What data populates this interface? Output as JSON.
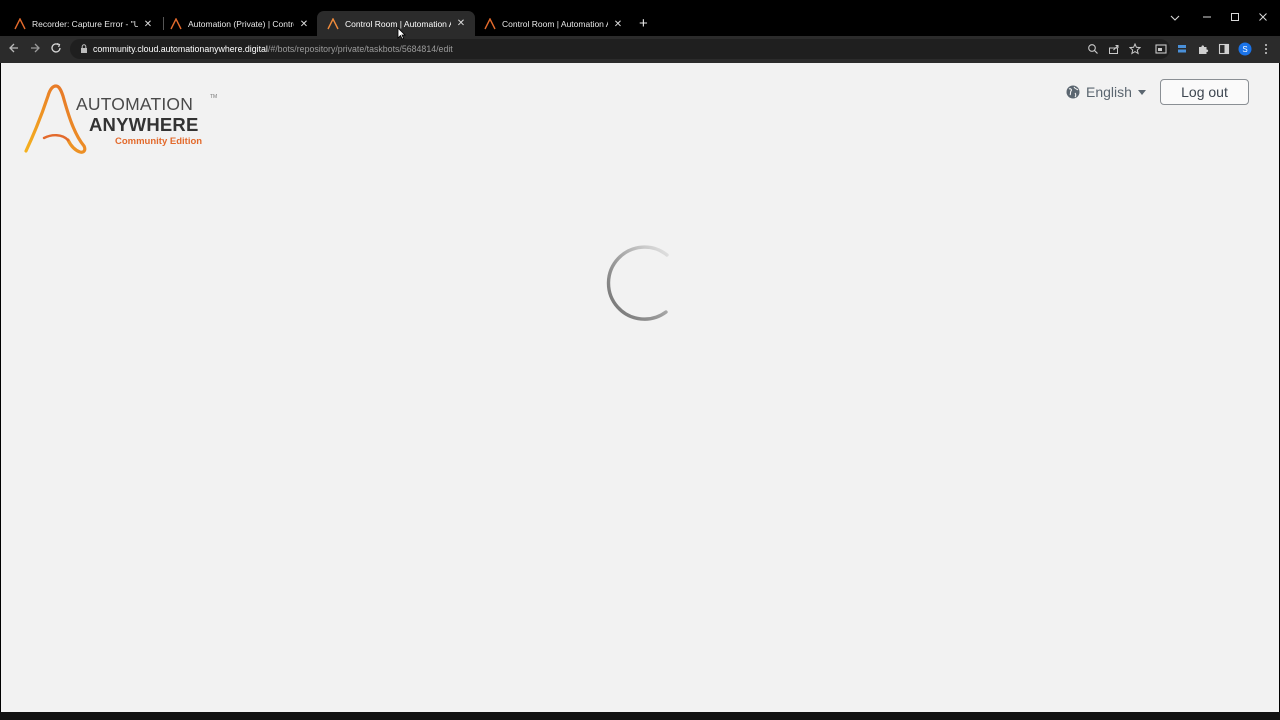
{
  "browser": {
    "tabs": [
      {
        "title": "Recorder: Capture Error - \"Unab",
        "active": false
      },
      {
        "title": "Automation (Private) | Control R",
        "active": false
      },
      {
        "title": "Control Room | Automation Any",
        "active": true
      },
      {
        "title": "Control Room | Automation Any",
        "active": false
      }
    ],
    "new_tab_glyph": "+",
    "close_glyph": "✕",
    "url_host": "community.cloud.automationanywhere.digital",
    "url_path": "/#/bots/repository/private/taskbots/5684814/edit",
    "profile_initial": "S"
  },
  "header": {
    "logo_line1": "AUTOMATION",
    "logo_tm": "TM",
    "logo_line2": "ANYWHERE",
    "logo_line3": "Community Edition",
    "language": "English",
    "logout_label": "Log out"
  },
  "colors": {
    "brand_orange": "#e36a2c",
    "brand_yellow": "#f5b21e",
    "page_bg": "#f2f2f2",
    "profile_blue": "#1a73e8"
  }
}
